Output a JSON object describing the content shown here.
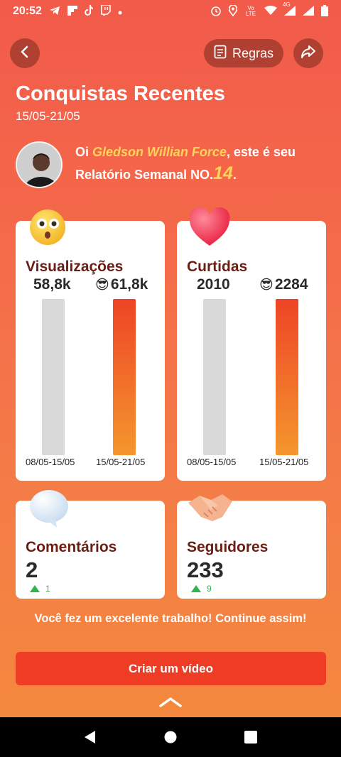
{
  "status_bar": {
    "time": "20:52",
    "left_icons": [
      "telegram-icon",
      "flipboard-icon",
      "tiktok-icon",
      "twitch-icon",
      "dot-icon"
    ],
    "right_icons": [
      "alarm-icon",
      "location-icon",
      "volte-icon",
      "wifi-icon",
      "signal-4g-icon",
      "signal-icon",
      "battery-icon"
    ],
    "volte_text": "Vo LTE",
    "net_text": "4G"
  },
  "header": {
    "rules_label": "Regras"
  },
  "page": {
    "title": "Conquistas Recentes",
    "dates": "15/05-21/05"
  },
  "greeting": {
    "prefix": "Oi ",
    "name": "Gledson Willian Force",
    "middle": ", este é seu",
    "line2": "Relatório Semanal NO.",
    "number": "14",
    "suffix": "."
  },
  "views": {
    "title": "Visualizações",
    "prev_value": "58,8k",
    "curr_value": "61,8k",
    "prev_label": "08/05-15/05",
    "curr_label": "15/05-21/05",
    "emoji": "😳",
    "cool_emoji": "😎"
  },
  "likes": {
    "title": "Curtidas",
    "prev_value": "2010",
    "curr_value": "2284",
    "prev_label": "08/05-15/05",
    "curr_label": "15/05-21/05",
    "emoji": "❤️",
    "cool_emoji": "😎"
  },
  "comments": {
    "title": "Comentários",
    "value": "2",
    "delta": "1",
    "emoji": "💬"
  },
  "followers": {
    "title": "Seguidores",
    "value": "233",
    "delta": "9",
    "emoji": "🤝"
  },
  "encourage_text": "Você fez um excelente trabalho! Continue assim!",
  "create_button_label": "Criar um vídeo",
  "colors": {
    "accent": "#ee3d24",
    "name_highlight": "#ffd35a",
    "card_title": "#6b1e14",
    "up_green": "#2fb44c"
  }
}
